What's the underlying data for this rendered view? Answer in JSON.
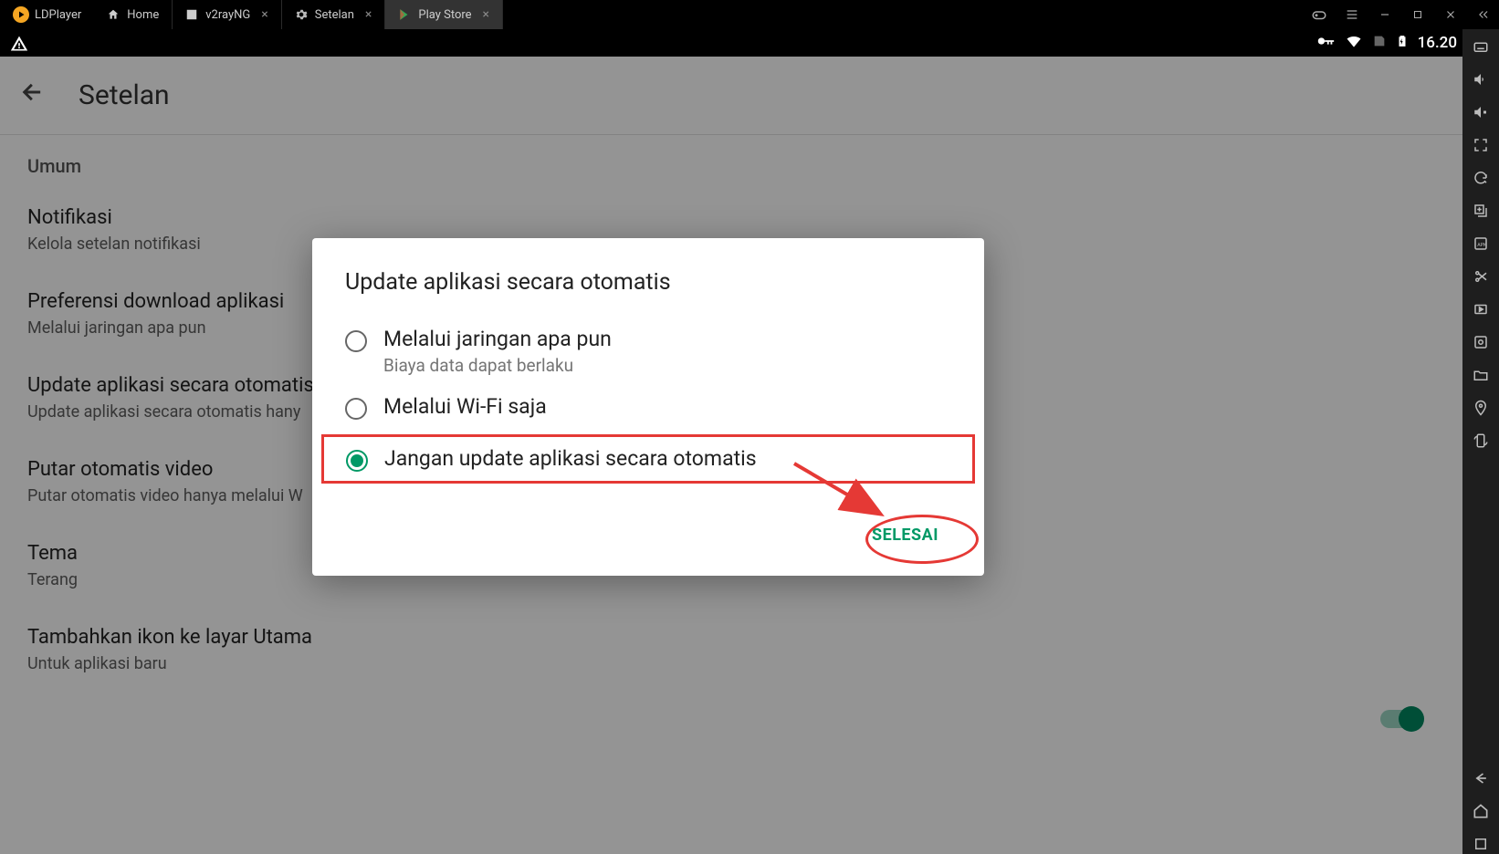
{
  "app_name": "LDPlayer",
  "tabs": [
    {
      "label": "Home"
    },
    {
      "label": "v2rayNG"
    },
    {
      "label": "Setelan"
    },
    {
      "label": "Play Store",
      "active": true
    }
  ],
  "time": "16.20",
  "settings": {
    "title": "Setelan",
    "section": "Umum",
    "items": [
      {
        "title": "Notifikasi",
        "sub": "Kelola setelan notifikasi"
      },
      {
        "title": "Preferensi download aplikasi",
        "sub": "Melalui jaringan apa pun"
      },
      {
        "title": "Update aplikasi secara otomatis",
        "sub": "Update aplikasi secara otomatis hany"
      },
      {
        "title": "Putar otomatis video",
        "sub": "Putar otomatis video hanya melalui W"
      },
      {
        "title": "Tema",
        "sub": "Terang"
      },
      {
        "title": "Tambahkan ikon ke layar Utama",
        "sub": "Untuk aplikasi baru"
      }
    ]
  },
  "dialog": {
    "title": "Update aplikasi secara otomatis",
    "options": [
      {
        "label": "Melalui jaringan apa pun",
        "sub": "Biaya data dapat berlaku",
        "selected": false
      },
      {
        "label": "Melalui Wi-Fi saja",
        "selected": false
      },
      {
        "label": "Jangan update aplikasi secara otomatis",
        "selected": true,
        "highlighted": true
      }
    ],
    "done": "SELESAI"
  }
}
